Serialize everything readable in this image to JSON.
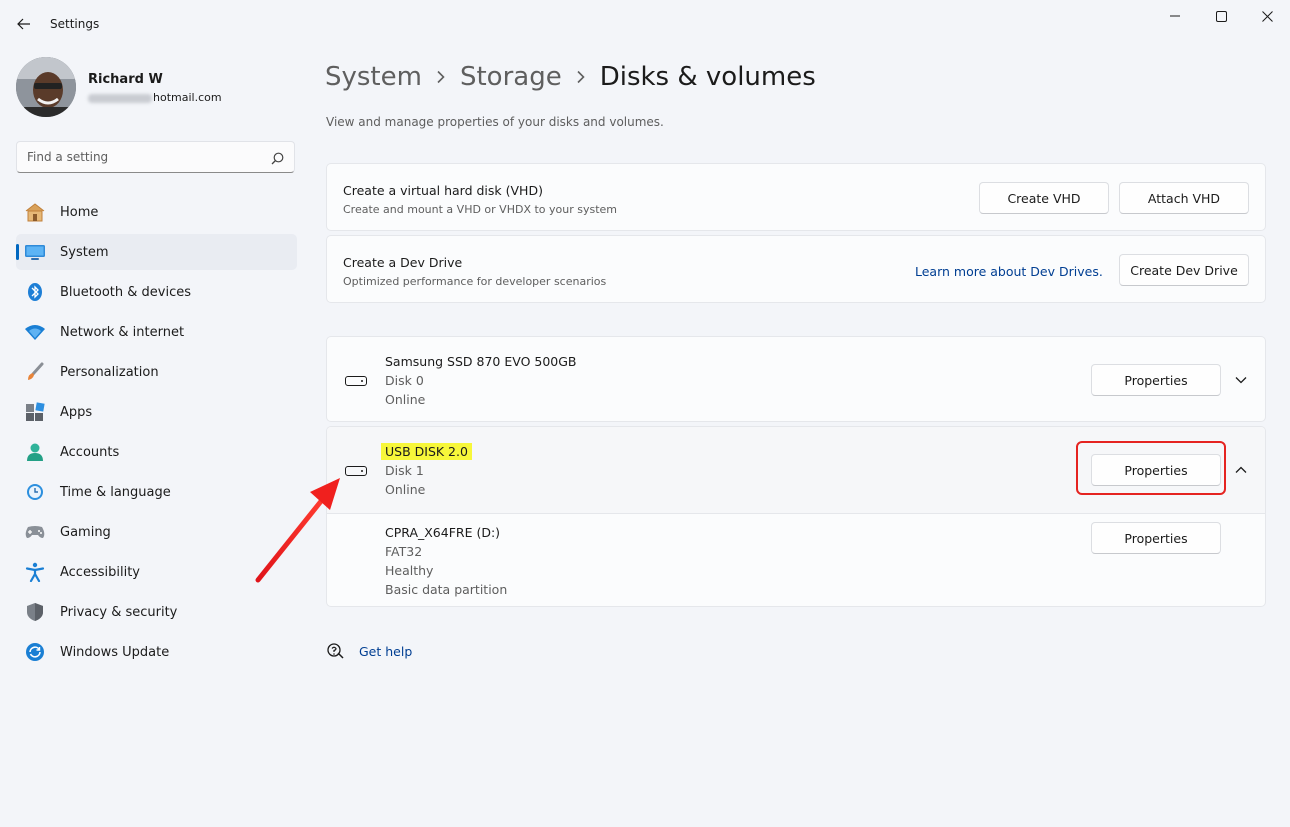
{
  "window": {
    "title": "Settings",
    "controls": [
      "minimize-icon",
      "maximize-icon",
      "close-icon"
    ]
  },
  "profile": {
    "name": "Richard W",
    "email_visible": "hotmail.com"
  },
  "search": {
    "placeholder": "Find a setting"
  },
  "sidebar": {
    "items": [
      {
        "label": "Home",
        "icon": "home-icon"
      },
      {
        "label": "System",
        "icon": "system-icon",
        "active": true
      },
      {
        "label": "Bluetooth & devices",
        "icon": "bluetooth-icon"
      },
      {
        "label": "Network & internet",
        "icon": "wifi-icon"
      },
      {
        "label": "Personalization",
        "icon": "brush-icon"
      },
      {
        "label": "Apps",
        "icon": "apps-icon"
      },
      {
        "label": "Accounts",
        "icon": "accounts-icon"
      },
      {
        "label": "Time & language",
        "icon": "clock-icon"
      },
      {
        "label": "Gaming",
        "icon": "gamepad-icon"
      },
      {
        "label": "Accessibility",
        "icon": "accessibility-icon"
      },
      {
        "label": "Privacy & security",
        "icon": "shield-icon"
      },
      {
        "label": "Windows Update",
        "icon": "update-icon"
      }
    ]
  },
  "breadcrumb": {
    "items": [
      "System",
      "Storage",
      "Disks & volumes"
    ]
  },
  "page": {
    "subtitle": "View and manage properties of your disks and volumes."
  },
  "vhd": {
    "title": "Create a virtual hard disk (VHD)",
    "description": "Create and mount a VHD or VHDX to your system",
    "create_label": "Create VHD",
    "attach_label": "Attach VHD"
  },
  "dev_drive": {
    "title": "Create a Dev Drive",
    "description": "Optimized performance for developer scenarios",
    "link_label": "Learn more about Dev Drives.",
    "button_label": "Create Dev Drive"
  },
  "disks": [
    {
      "name": "Samsung SSD 870 EVO 500GB",
      "disk": "Disk 0",
      "status": "Online",
      "button_label": "Properties",
      "expanded": false
    },
    {
      "name": "USB DISK 2.0",
      "disk": "Disk 1",
      "status": "Online",
      "button_label": "Properties",
      "expanded": true,
      "volumes": [
        {
          "name": "CPRA_X64FRE (D:)",
          "filesystem": "FAT32",
          "health": "Healthy",
          "type": "Basic data partition",
          "button_label": "Properties"
        }
      ]
    }
  ],
  "help": {
    "label": "Get help"
  },
  "colors": {
    "accent": "#0067c0",
    "annotation_red": "#e52421",
    "highlight_yellow": "#f7f73a",
    "link": "#003e92"
  }
}
